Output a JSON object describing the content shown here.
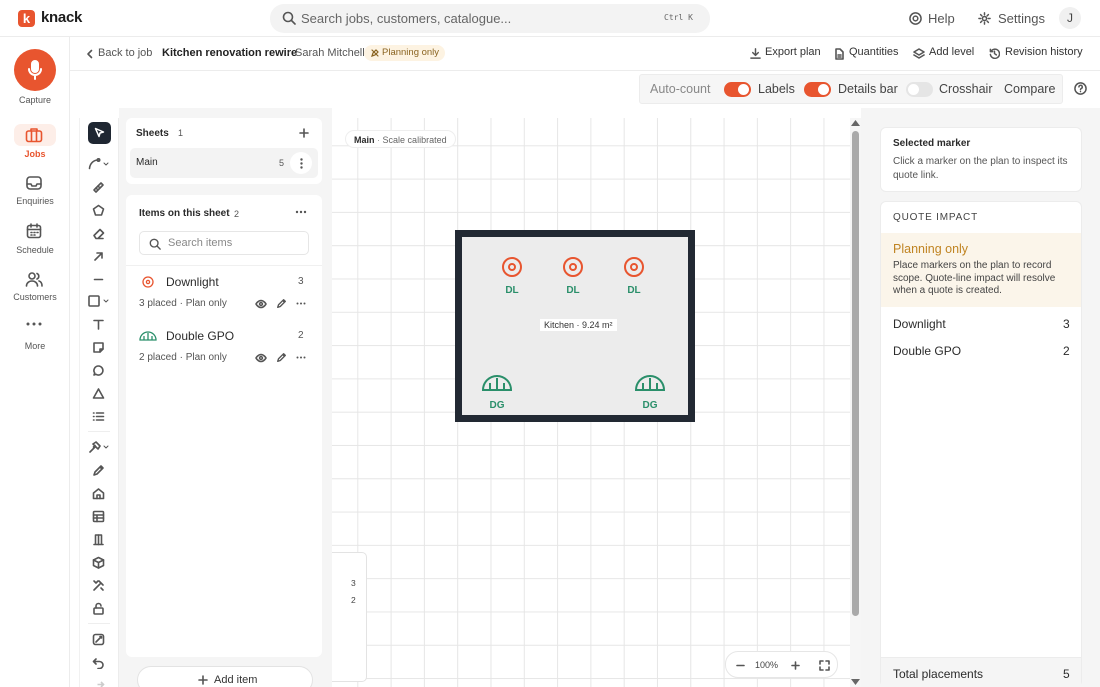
{
  "topbar": {
    "logo_letter": "k",
    "logo_text": "knack",
    "search_placeholder": "Search jobs, customers, catalogue...",
    "search_shortcut": "Ctrl K",
    "help": "Help",
    "settings": "Settings",
    "avatar": "J"
  },
  "breadcrumb": {
    "back": "Back to job",
    "job": "Kitchen renovation rewire",
    "sep": "·",
    "customer": "Sarah Mitchell",
    "badge": "Planning only"
  },
  "actions": {
    "export": "Export plan",
    "quantities": "Quantities",
    "add_level": "Add level",
    "revision": "Revision history"
  },
  "nav": {
    "capture": "Capture",
    "jobs": "Jobs",
    "enquiries": "Enquiries",
    "schedule": "Schedule",
    "customers": "Customers",
    "more": "More"
  },
  "toggles": {
    "auto_count": "Auto-count",
    "labels": "Labels",
    "details_bar": "Details bar",
    "crosshair": "Crosshair",
    "compare": "Compare"
  },
  "sheets": {
    "title": "Sheets",
    "count": "1",
    "items": [
      {
        "name": "Main",
        "count": "5"
      }
    ]
  },
  "items_panel": {
    "title": "Items on this sheet",
    "count": "2",
    "search_placeholder": "Search items",
    "items": [
      {
        "name": "Downlight",
        "count": "3",
        "meta": "3 placed · Plan only"
      },
      {
        "name": "Double GPO",
        "count": "2",
        "meta": "2 placed · Plan only"
      }
    ],
    "add_item": "Add item"
  },
  "canvas": {
    "sheet": "Main",
    "dot": "·",
    "status": "Scale calibrated",
    "room_label": "Kitchen · 9.24 m²",
    "markers": {
      "downlight": "DL",
      "gpo": "DG"
    },
    "mini_counts": [
      "3",
      "2"
    ],
    "zoom": "100%"
  },
  "right": {
    "selected_title": "Selected marker",
    "selected_text": "Click a marker on the plan to inspect its quote link.",
    "qi_title": "QUOTE IMPACT",
    "plan_title": "Planning only",
    "plan_text": "Place markers on the plan to record scope. Quote-line impact will resolve when a quote is created.",
    "rows": [
      {
        "name": "Downlight",
        "count": "3"
      },
      {
        "name": "Double GPO",
        "count": "2"
      }
    ],
    "total_label": "Total placements",
    "total": "5"
  },
  "colors": {
    "accent": "#e8552f",
    "marker": "#2a8f6a",
    "room_wall": "#222933"
  }
}
